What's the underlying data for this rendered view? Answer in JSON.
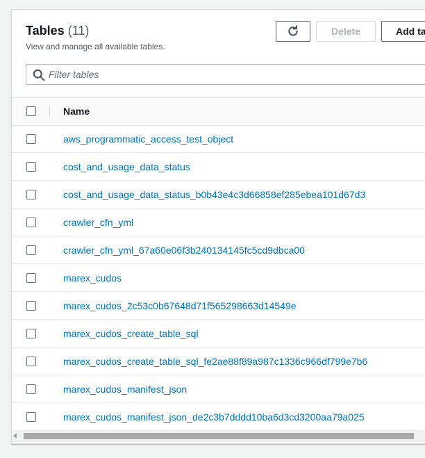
{
  "header": {
    "title": "Tables",
    "count": "(11)",
    "description": "View and manage all available tables."
  },
  "toolbar": {
    "refresh_icon": "refresh-icon",
    "delete_label": "Delete",
    "add_label": "Add tables"
  },
  "search": {
    "placeholder": "Filter tables",
    "icon": "search-icon"
  },
  "table": {
    "columns": [
      "Name"
    ],
    "rows": [
      "aws_programmatic_access_test_object",
      "cost_and_usage_data_status",
      "cost_and_usage_data_status_b0b43e4c3d66858ef285ebea101d67d3",
      "crawler_cfn_yml",
      "crawler_cfn_yml_67a60e06f3b240134145fc5cd9dbca00",
      "marex_cudos",
      "marex_cudos_2c53c0b67648d71f565298663d14549e",
      "marex_cudos_create_table_sql",
      "marex_cudos_create_table_sql_fe2ae88f89a987c1336c966df799e7b6",
      "marex_cudos_manifest_json",
      "marex_cudos_manifest_json_de2c3b7dddd10ba6d3cd3200aa79a025"
    ]
  },
  "colors": {
    "link": "#0073bb",
    "text": "#16191f",
    "secondary_text": "#545b64",
    "border": "#eaeded"
  }
}
